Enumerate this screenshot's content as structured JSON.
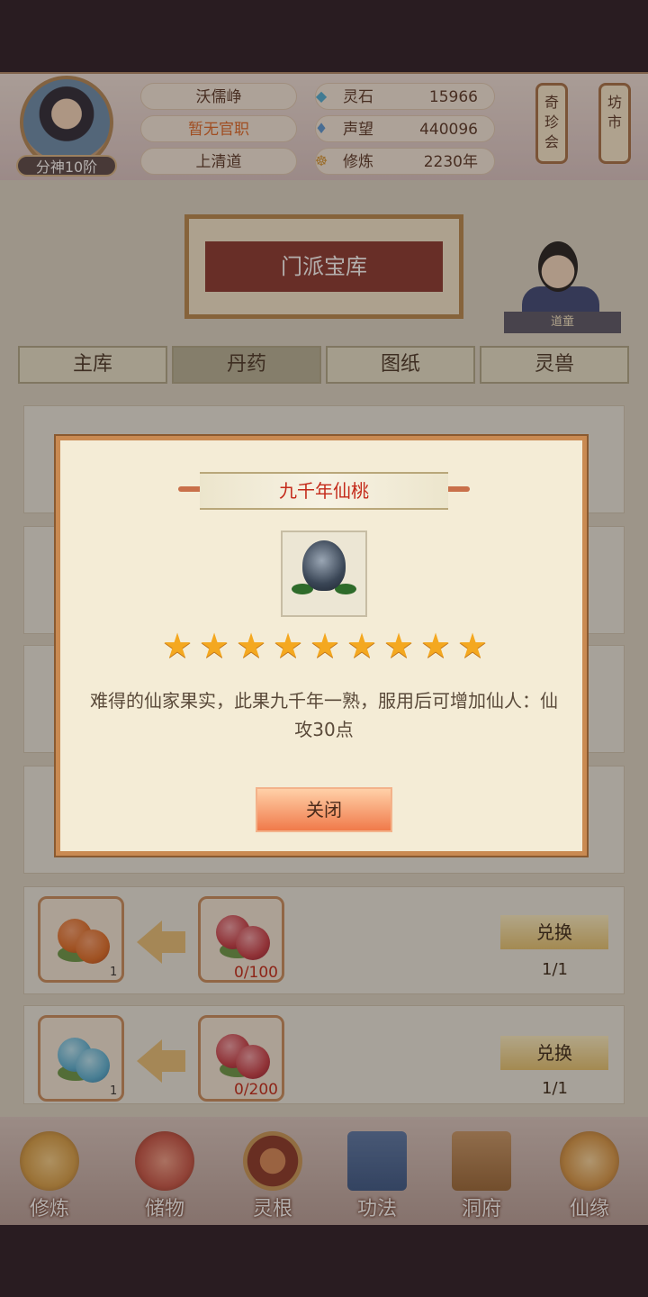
{
  "player": {
    "name": "沃儒峥",
    "official_title": "暂无官职",
    "sect": "上清道",
    "rank": "分神10阶"
  },
  "stats": [
    {
      "label": "灵石",
      "value": "15966",
      "icon": "spirit-stone-icon",
      "icon_glyph": "◆",
      "icon_color": "#4fb0d8"
    },
    {
      "label": "声望",
      "value": "440096",
      "icon": "reputation-crystal-icon",
      "icon_glyph": "♦",
      "icon_color": "#5a9ad8"
    },
    {
      "label": "修炼",
      "value": "2230年",
      "icon": "meditation-icon",
      "icon_glyph": "☸",
      "icon_color": "#d89a3a"
    }
  ],
  "lanterns": [
    {
      "label": "奇珍会"
    },
    {
      "label": "坊市"
    }
  ],
  "page_title": "门派宝库",
  "npc_tag": "道童",
  "tabs": [
    {
      "label": "主库",
      "active": false
    },
    {
      "label": "丹药",
      "active": true
    },
    {
      "label": "图纸",
      "active": false
    },
    {
      "label": "灵兽",
      "active": false
    }
  ],
  "exchange_rows": [
    {
      "give_count": "1",
      "require": "0/100",
      "button": "兑换",
      "limit": "1/1",
      "give_color": "#e0702a",
      "require_color": "#c8404a"
    },
    {
      "give_count": "1",
      "require": "0/200",
      "button": "兑换",
      "limit": "1/1",
      "give_color": "#5ab4d8",
      "require_color": "#c8404a"
    }
  ],
  "modal": {
    "title": "九千年仙桃",
    "stars": 9,
    "description": "难得的仙家果实，此果九千年一熟，服用后可增加仙人：仙攻30点",
    "close_label": "关闭"
  },
  "bottom_nav": [
    {
      "label": "修炼",
      "icon": "cultivation-icon",
      "color": "#d8a24a"
    },
    {
      "label": "储物",
      "icon": "storage-bag-icon",
      "color": "#c8584a"
    },
    {
      "label": "灵根",
      "icon": "spirit-root-icon",
      "color": "#8a3a2a"
    },
    {
      "label": "功法",
      "icon": "technique-book-icon",
      "color": "#3a5a8a"
    },
    {
      "label": "洞府",
      "icon": "cave-residence-icon",
      "color": "#9a6a3a"
    },
    {
      "label": "仙缘",
      "icon": "gourd-icon",
      "color": "#d89a4a"
    }
  ]
}
